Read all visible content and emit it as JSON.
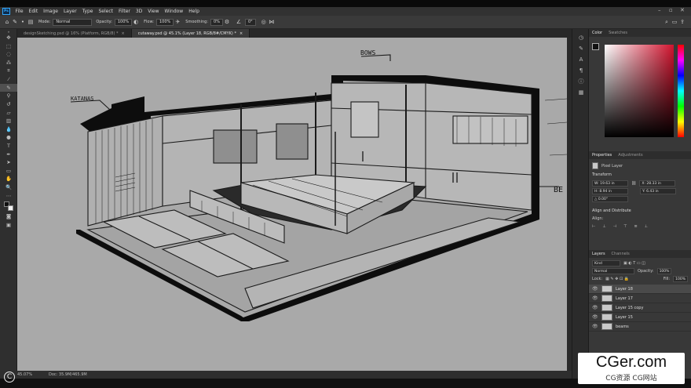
{
  "app": {
    "logo": "Ps"
  },
  "menu": [
    "File",
    "Edit",
    "Image",
    "Layer",
    "Type",
    "Select",
    "Filter",
    "3D",
    "View",
    "Window",
    "Help"
  ],
  "options": {
    "mode_label": "Mode:",
    "mode_value": "Normal",
    "opacity_label": "Opacity:",
    "opacity_value": "100%",
    "flow_label": "Flow:",
    "flow_value": "100%",
    "smoothing_label": "Smoothing:",
    "smoothing_value": "0%",
    "angle_value": "0°"
  },
  "tabs": [
    {
      "label": "designSketching.psd @ 16% (Platform, RGB/8) *"
    },
    {
      "label": "cutaway.psd @ 45.1% (Layer 18, RGB/8#/CMYK) *"
    }
  ],
  "canvas_labels": {
    "katanas": "KATANAS",
    "bows": "BOWS",
    "be": "BE"
  },
  "status": {
    "zoom": "45.07%",
    "doc": "Doc: 35.9M/465.9M"
  },
  "color_panel": {
    "tab1": "Color",
    "tab2": "Swatches"
  },
  "properties_panel": {
    "tab1": "Properties",
    "tab2": "Adjustments",
    "type": "Pixel Layer",
    "transform_h": "Transform",
    "w": "W: 19.63 in",
    "x": "X: 28.33 in",
    "h": "H: 8.94 in",
    "y": "Y: 6.43 in",
    "angle": "△ 0.00°",
    "align_h": "Align and Distribute",
    "align_label": "Align:"
  },
  "layers_panel": {
    "tab1": "Layers",
    "tab2": "Channels",
    "kind": "Kind",
    "blend": "Normal",
    "opacity_label": "Opacity:",
    "opacity": "100%",
    "lock_label": "Lock:",
    "fill_label": "Fill:",
    "fill": "100%",
    "layers": [
      {
        "name": "Layer 18",
        "selected": true
      },
      {
        "name": "Layer 17",
        "selected": false
      },
      {
        "name": "Layer 15 copy",
        "selected": false
      },
      {
        "name": "Layer 15",
        "selected": false
      },
      {
        "name": "beams",
        "selected": false
      }
    ]
  },
  "watermark": {
    "main": "CGer.com",
    "sub": "CG资源 CG网站"
  },
  "copyright": "C",
  "colors": {
    "accent": "#31a8ff",
    "canvas_bg": "#a9a9a9"
  }
}
